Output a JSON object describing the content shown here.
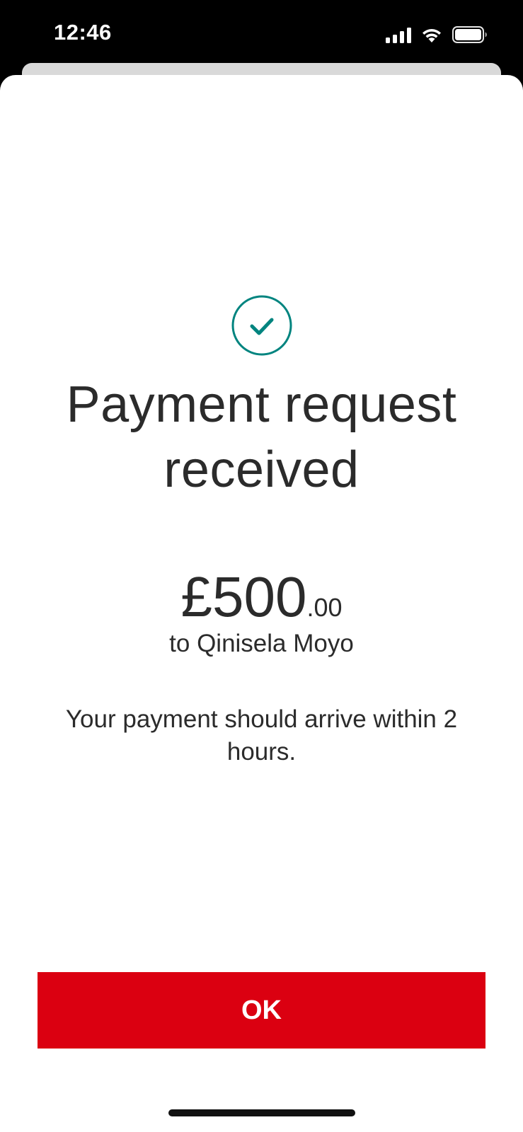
{
  "status_bar": {
    "time": "12:46",
    "icons": [
      "signal-icon",
      "wifi-icon",
      "battery-icon"
    ]
  },
  "confirmation": {
    "icon": "check-circle-icon",
    "icon_color": "#00847f",
    "title": "Payment request received",
    "amount_major": "£500",
    "amount_minor": ".00",
    "recipient": "to Qinisela Moyo",
    "arrival_message": "Your payment should arrive within 2 hours."
  },
  "actions": {
    "ok_label": "OK",
    "ok_color": "#db0011"
  }
}
